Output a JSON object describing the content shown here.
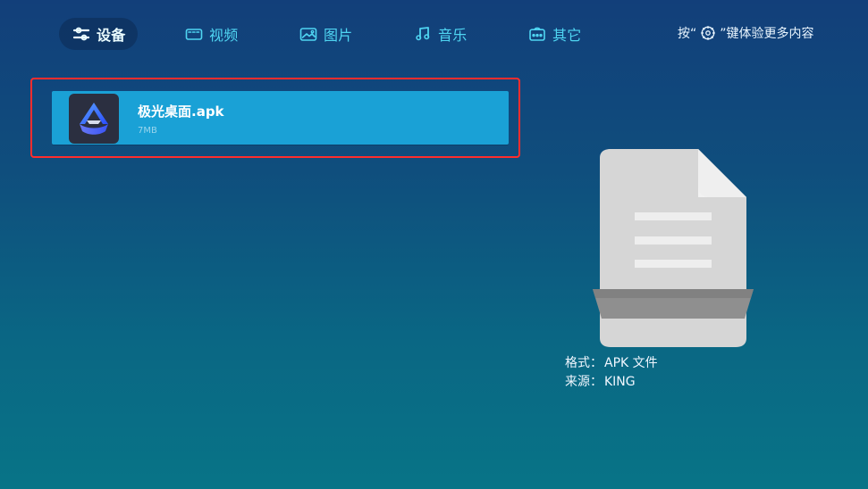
{
  "tabs": [
    {
      "label": "设备",
      "icon": "settings-sliders-icon",
      "active": true
    },
    {
      "label": "视频",
      "icon": "video-icon",
      "active": false
    },
    {
      "label": "图片",
      "icon": "image-icon",
      "active": false
    },
    {
      "label": "音乐",
      "icon": "music-note-icon",
      "active": false
    },
    {
      "label": "其它",
      "icon": "more-icon",
      "active": false
    }
  ],
  "hint": {
    "prefix": "按“",
    "suffix": "”键体验更多内容",
    "icon": "gear-icon"
  },
  "files": [
    {
      "name": "极光桌面.apk",
      "size": "7MB",
      "icon": "app-icon"
    }
  ],
  "details": {
    "format_label": "格式：",
    "format_value": "APK 文件",
    "source_label": "来源：",
    "source_value": "KING",
    "preview_icon": "document-icon"
  },
  "colors": {
    "accent": "#4fd5f2",
    "selection": "#1aa1d6",
    "highlight_border": "#ff2d2d"
  }
}
